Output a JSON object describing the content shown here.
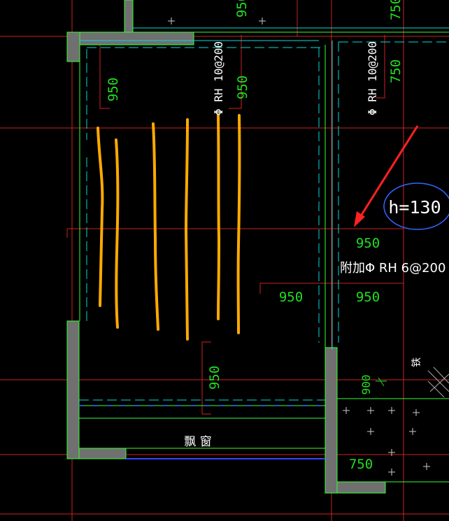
{
  "dimensions": {
    "left_top": "950",
    "mid_top": "950",
    "right_top": "750",
    "right_top_upper": "750",
    "top_center_fragment": "950",
    "center_horizontal": "950",
    "bottom_left": "950",
    "bottom_mid": "950",
    "vertical_lower": "950",
    "right_vertical": "900",
    "right_bottom": "750"
  },
  "rebar_labels": {
    "left": "Φ RH 10@200",
    "right": "Φ RH 10@200",
    "additional": "附加Φ RH 6@200"
  },
  "annotation": {
    "thickness": "h=130"
  },
  "room_labels": {
    "bay_window": "飘 窗",
    "right_small": "铁"
  },
  "colors": {
    "background": "#000000",
    "dimension_text": "#22dd22",
    "wall_outline": "#33ff33",
    "wall_fill": "#707070",
    "axis_red": "#cc2222",
    "slab_cyan": "#00dddd",
    "blue_line": "#3344ff",
    "highlight_orange": "#ffaa00",
    "arrow_red": "#ff2222",
    "ellipse_blue": "#3366ff",
    "white_text": "#ffffff"
  }
}
